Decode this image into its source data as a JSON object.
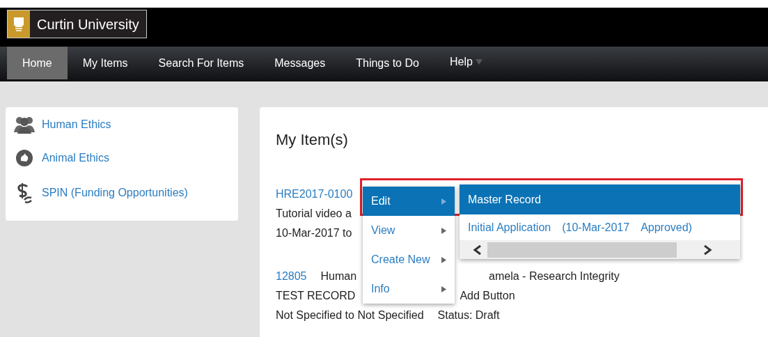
{
  "brand": {
    "name": "Curtin University"
  },
  "nav": [
    {
      "label": "Home",
      "selected": true,
      "dropdown": false
    },
    {
      "label": "My Items",
      "selected": false,
      "dropdown": false
    },
    {
      "label": "Search For Items",
      "selected": false,
      "dropdown": false
    },
    {
      "label": "Messages",
      "selected": false,
      "dropdown": false
    },
    {
      "label": "Things to Do",
      "selected": false,
      "dropdown": false
    },
    {
      "label": "Help",
      "selected": false,
      "dropdown": true
    }
  ],
  "sidebar": {
    "items": [
      {
        "label": "Human Ethics",
        "kind": "people"
      },
      {
        "label": "Animal Ethics",
        "kind": "animal"
      },
      {
        "label": "SPIN (Funding Opportunities)",
        "kind": "money"
      }
    ]
  },
  "main": {
    "title": "My Item(s)",
    "items": [
      {
        "lines": [
          [
            "HRE2017-0100"
          ],
          [
            "Tutorial video a"
          ],
          [
            "10-Mar-2017 to"
          ]
        ]
      },
      {
        "lines": [
          [
            "12805",
            "Human",
            "amela - Research Integrity"
          ],
          [
            "TEST RECORD",
            "Add Button"
          ],
          [
            "Not Specified to Not Specified",
            "Status: Draft"
          ]
        ]
      }
    ]
  },
  "context_menu": {
    "items": [
      {
        "label": "Edit",
        "selected": true
      },
      {
        "label": "View",
        "selected": false
      },
      {
        "label": "Create New",
        "selected": false
      },
      {
        "label": "Info",
        "selected": false
      }
    ],
    "submenu": {
      "items": [
        {
          "label": "Master Record",
          "selected": true
        },
        {
          "label": "Initial Application",
          "date": "(10-Mar-2017",
          "status": "Approved)",
          "selected": false
        }
      ]
    }
  }
}
